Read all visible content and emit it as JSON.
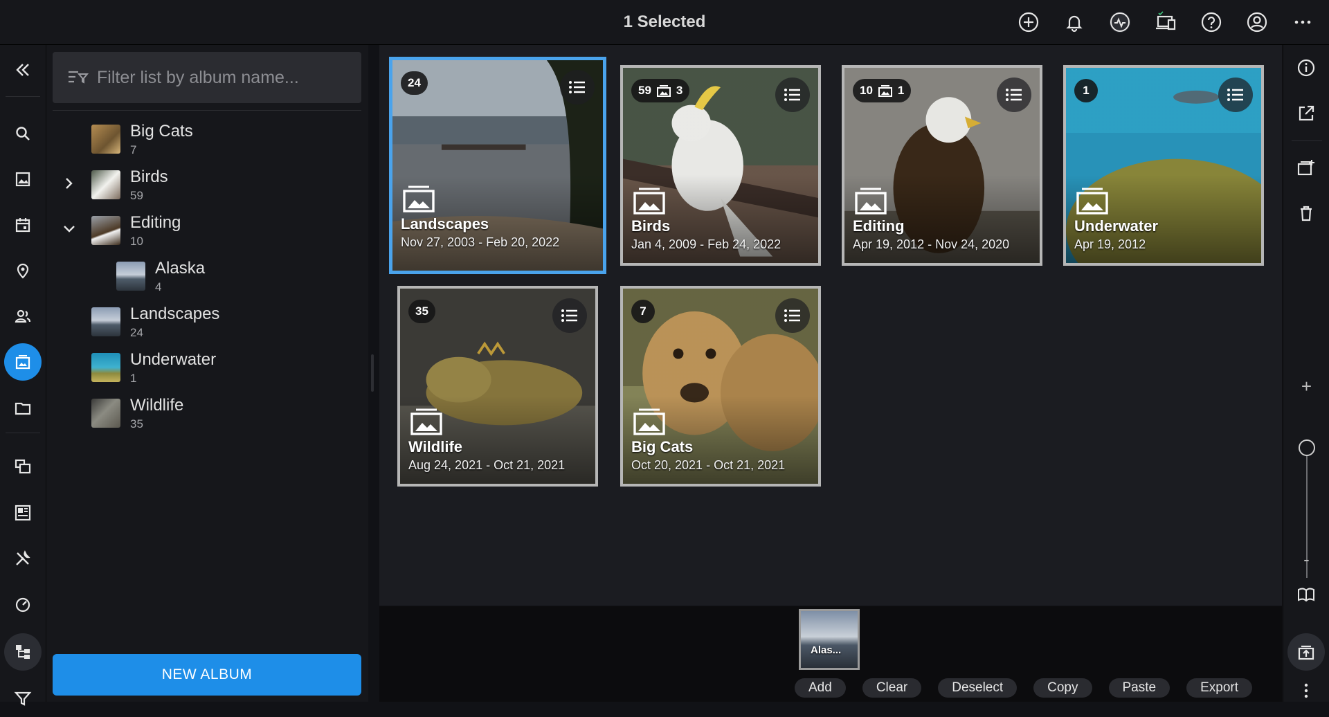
{
  "topbar": {
    "title": "1 Selected",
    "icons": [
      "add-circle-icon",
      "bell-icon",
      "activity-icon",
      "devices-icon",
      "help-icon",
      "account-icon",
      "more-horizontal-icon"
    ]
  },
  "sidebar": {
    "filter_placeholder": "Filter list by album name...",
    "albums": [
      {
        "name": "Big Cats",
        "count": "7"
      },
      {
        "name": "Birds",
        "count": "59"
      },
      {
        "name": "Editing",
        "count": "10"
      },
      {
        "name": "Alaska",
        "count": "4"
      },
      {
        "name": "Landscapes",
        "count": "24"
      },
      {
        "name": "Underwater",
        "count": "1"
      },
      {
        "name": "Wildlife",
        "count": "35"
      }
    ],
    "new_album_label": "NEW ALBUM"
  },
  "grid": {
    "cards": [
      {
        "title": "Landscapes",
        "dates": "Nov 27, 2003 - Feb 20, 2022",
        "count": "24",
        "sub_count": ""
      },
      {
        "title": "Birds",
        "dates": "Jan 4, 2009 - Feb 24, 2022",
        "count": "59",
        "sub_count": "3"
      },
      {
        "title": "Editing",
        "dates": "Apr 19, 2012 - Nov 24, 2020",
        "count": "10",
        "sub_count": "1"
      },
      {
        "title": "Underwater",
        "dates": "Apr 19, 2012",
        "count": "1",
        "sub_count": ""
      },
      {
        "title": "Wildlife",
        "dates": "Aug 24, 2021 - Oct 21, 2021",
        "count": "35",
        "sub_count": ""
      },
      {
        "title": "Big Cats",
        "dates": "Oct 20, 2021 - Oct 21, 2021",
        "count": "7",
        "sub_count": ""
      }
    ],
    "selected_index": 0
  },
  "tray": {
    "thumb_label": "Alas...",
    "buttons": [
      "Add",
      "Clear",
      "Deselect",
      "Copy",
      "Paste",
      "Export"
    ]
  },
  "rightrail": {
    "zoom_plus": "+",
    "zoom_minus": "-",
    "zoom_level": 0.5
  }
}
